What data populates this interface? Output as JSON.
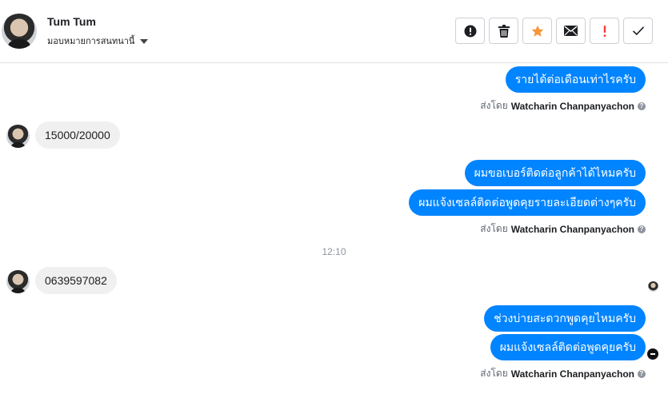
{
  "header": {
    "contact_name": "Tum Tum",
    "assign_label": "มอบหมายการสนทนานี้"
  },
  "toolbar": {
    "buttons": [
      {
        "name": "alert-circle-button",
        "icon": "exclamation-circle-icon",
        "color": "#1c1e21"
      },
      {
        "name": "delete-button",
        "icon": "trash-icon",
        "color": "#1c1e21"
      },
      {
        "name": "star-button",
        "icon": "star-icon",
        "color": "#f5963a"
      },
      {
        "name": "mark-unread-button",
        "icon": "envelope-icon",
        "color": "#1c1e21"
      },
      {
        "name": "spam-button",
        "icon": "exclamation-icon",
        "color": "#fa383e"
      },
      {
        "name": "mark-done-button",
        "icon": "check-icon",
        "color": "#1c1e21"
      }
    ]
  },
  "messages": {
    "out1": "รายได้ต่อเดือนเท่าไรครับ",
    "in1": "15000/20000",
    "out2": "ผมขอเบอร์ติดต่อลูกค้าได้ไหมครับ",
    "out3": "ผมแจ้งเซลล์ติดต่อพูดคุยรายละเอียดต่างๆครับ",
    "time": "12:10",
    "in2": "0639597082",
    "out4": "ช่วงบ่ายสะดวกพูดคุยไหมครับ",
    "out5": "ผมแจ้งเซลล์ติดต่อพูดคุยครับ"
  },
  "sent_by": {
    "prefix": "ส่งโดย",
    "sender": "Watcharin Chanpanyachon",
    "help": "?"
  },
  "colors": {
    "outgoing_bubble": "#0084ff",
    "incoming_bubble": "#f0f0f0",
    "star": "#f5963a",
    "spam": "#fa383e"
  }
}
